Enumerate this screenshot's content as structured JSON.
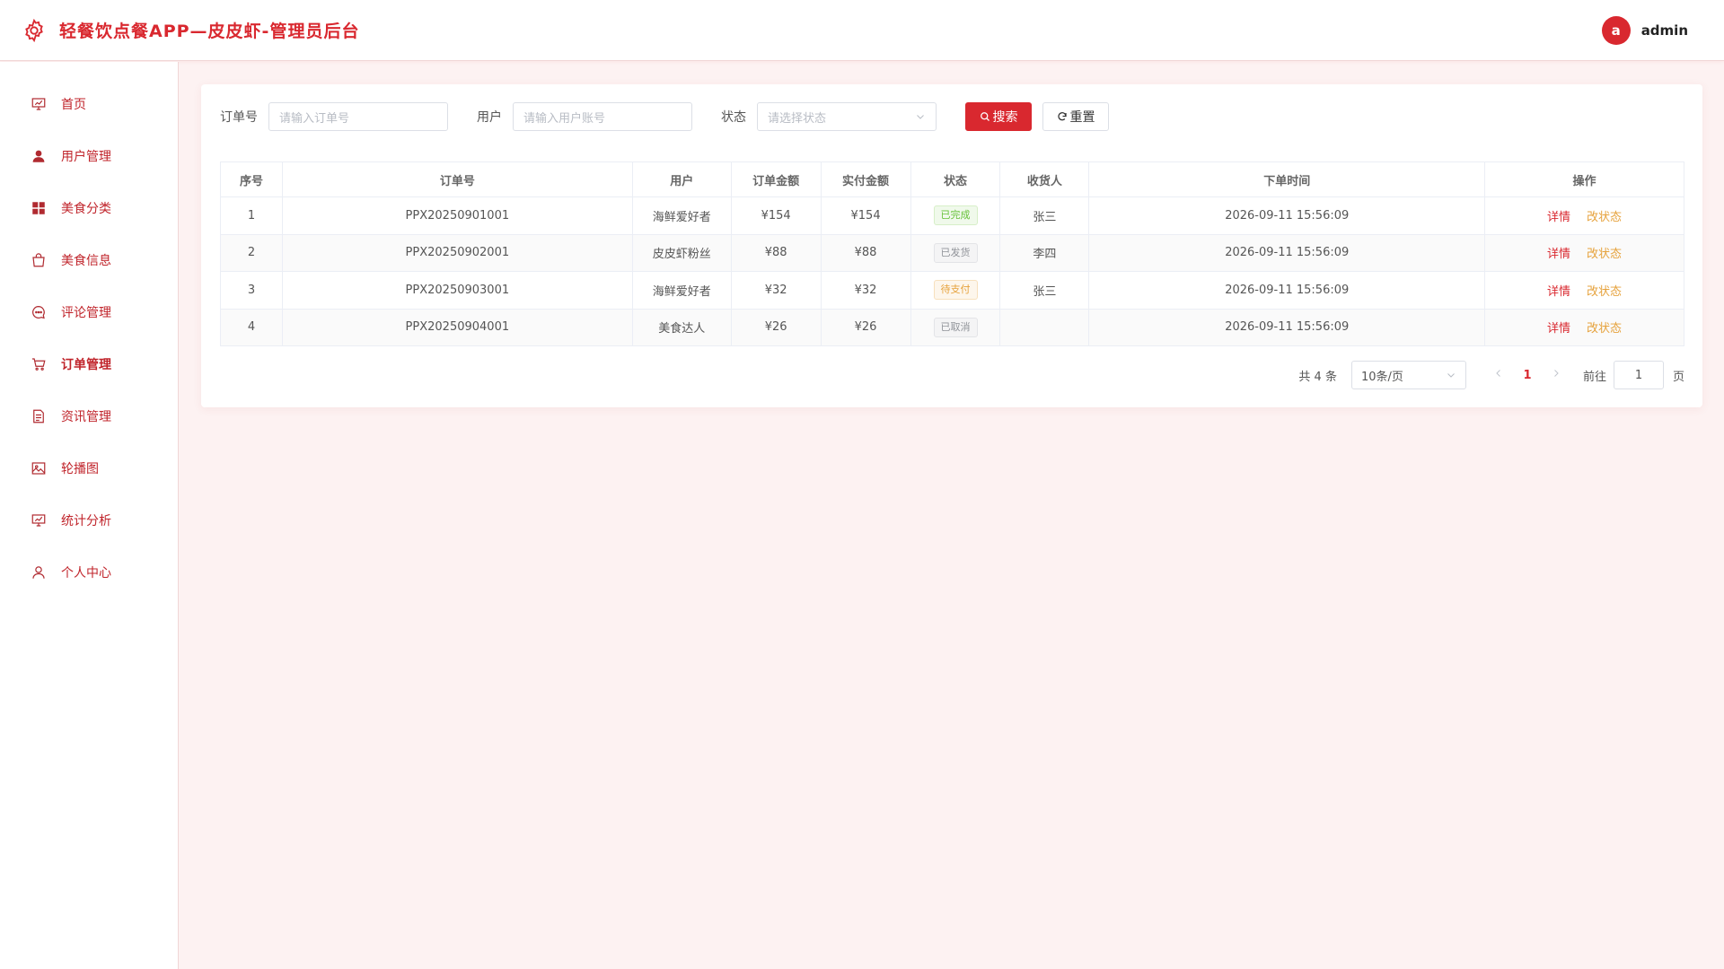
{
  "header": {
    "title": "轻餐饮点餐APP—皮皮虾-管理员后台",
    "avatar_letter": "a",
    "username": "admin"
  },
  "sidebar": {
    "items": [
      {
        "label": "首页",
        "icon": "monitor-chart-icon"
      },
      {
        "label": "用户管理",
        "icon": "user-icon"
      },
      {
        "label": "美食分类",
        "icon": "grid-icon"
      },
      {
        "label": "美食信息",
        "icon": "bag-icon"
      },
      {
        "label": "评论管理",
        "icon": "chat-icon"
      },
      {
        "label": "订单管理",
        "icon": "cart-icon"
      },
      {
        "label": "资讯管理",
        "icon": "document-icon"
      },
      {
        "label": "轮播图",
        "icon": "picture-icon"
      },
      {
        "label": "统计分析",
        "icon": "monitor-chart-icon"
      },
      {
        "label": "个人中心",
        "icon": "user-outline-icon"
      }
    ],
    "active": "订单管理"
  },
  "search": {
    "order_label": "订单号",
    "order_placeholder": "请输入订单号",
    "user_label": "用户",
    "user_placeholder": "请输入用户账号",
    "status_label": "状态",
    "status_placeholder": "请选择状态",
    "search_button": "搜索",
    "reset_button": "重置"
  },
  "table": {
    "columns": [
      "序号",
      "订单号",
      "用户",
      "订单金额",
      "实付金额",
      "状态",
      "收货人",
      "下单时间",
      "操作"
    ],
    "rows": [
      {
        "index": "1",
        "order_no": "PPX20250901001",
        "user": "海鲜爱好者",
        "amount": "¥154",
        "paid": "¥154",
        "status": "已完成",
        "status_color": "green",
        "receiver": "张三",
        "time": "2026-09-11 15:56:09"
      },
      {
        "index": "2",
        "order_no": "PPX20250902001",
        "user": "皮皮虾粉丝",
        "amount": "¥88",
        "paid": "¥88",
        "status": "已发货",
        "status_color": "gray",
        "receiver": "李四",
        "time": "2026-09-11 15:56:09"
      },
      {
        "index": "3",
        "order_no": "PPX20250903001",
        "user": "海鲜爱好者",
        "amount": "¥32",
        "paid": "¥32",
        "status": "待支付",
        "status_color": "orange",
        "receiver": "张三",
        "time": "2026-09-11 15:56:09"
      },
      {
        "index": "4",
        "order_no": "PPX20250904001",
        "user": "美食达人",
        "amount": "¥26",
        "paid": "¥26",
        "status": "已取消",
        "status_color": "gray",
        "receiver": "",
        "time": "2026-09-11 15:56:09"
      }
    ],
    "action_detail": "详情",
    "action_status": "改状态"
  },
  "pagination": {
    "total_text": "共 4 条",
    "page_size": "10条/页",
    "current_page": "1",
    "goto_label": "前往",
    "goto_value": "1",
    "page_suffix": "页"
  },
  "colors": {
    "accent": "#d9282f",
    "background": "#fdf2f2",
    "warning": "#e6a23c",
    "success": "#67c23a"
  }
}
